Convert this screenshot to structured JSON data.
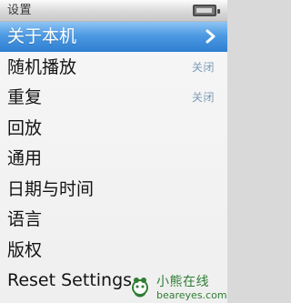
{
  "titlebar": {
    "title": "设置",
    "battery_icon": "battery-icon"
  },
  "menu": {
    "items": [
      {
        "label": "关于本机",
        "value": "",
        "selected": true,
        "icon": "chevron-right-icon"
      },
      {
        "label": "随机播放",
        "value": "关闭",
        "selected": false
      },
      {
        "label": "重复",
        "value": "关闭",
        "selected": false
      },
      {
        "label": "回放",
        "value": "",
        "selected": false
      },
      {
        "label": "通用",
        "value": "",
        "selected": false
      },
      {
        "label": "日期与时间",
        "value": "",
        "selected": false
      },
      {
        "label": "语言",
        "value": "",
        "selected": false
      },
      {
        "label": "版权",
        "value": "",
        "selected": false
      },
      {
        "label": "Reset Settings",
        "value": "",
        "selected": false
      }
    ]
  },
  "watermark": {
    "name": "小熊在线",
    "url": "beareyes.com",
    "logo_icon": "bear-logo-icon"
  },
  "colors": {
    "selected_gradient_top": "#8fc4f4",
    "selected_gradient_bottom": "#2f7fd1",
    "value_text": "#7b9bb9",
    "watermark_green": "#2e7d32"
  }
}
